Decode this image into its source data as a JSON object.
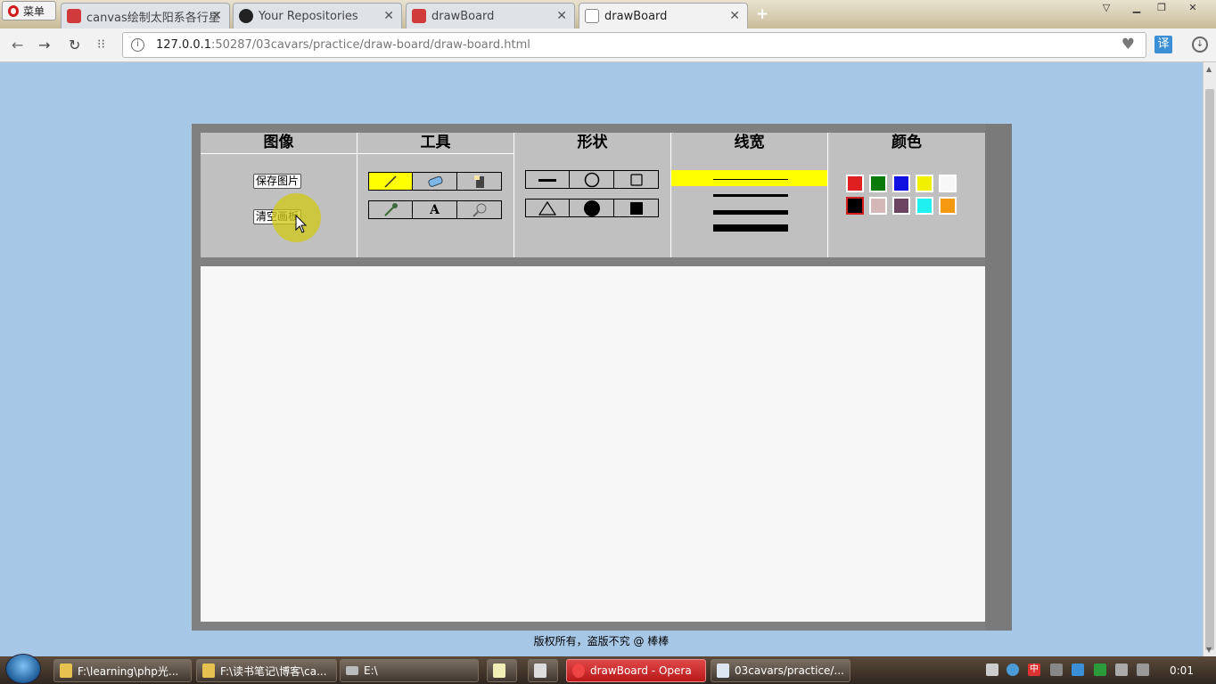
{
  "browser": {
    "menu_label": "菜单",
    "tabs": [
      {
        "title": "canvas绘制太阳系各行星",
        "favicon_color": "#d03a3a"
      },
      {
        "title": "Your Repositories",
        "favicon_color": "#222222"
      },
      {
        "title": "drawBoard",
        "favicon_color": "#d03a3a"
      },
      {
        "title": "drawBoard",
        "favicon_color": "#888888"
      }
    ],
    "url_host": "127.0.0.1",
    "url_rest": ":50287/03cavars/practice/draw-board/draw-board.html",
    "translate_label": "译"
  },
  "board": {
    "sections": [
      {
        "title": "图像",
        "buttons": [
          "保存图片",
          "清空画板"
        ]
      },
      {
        "title": "工具"
      },
      {
        "title": "形状"
      },
      {
        "title": "线宽"
      },
      {
        "title": "颜色"
      }
    ],
    "tool_text_label": "A",
    "selected_line_width_index": 0,
    "colors_row1": [
      "#e02020",
      "#0a7a0a",
      "#1010e0",
      "#f0f000",
      "#f7f7f7"
    ],
    "colors_row2": [
      "#000000",
      "#d4b8b8",
      "#6a4460",
      "#20f0f0",
      "#f59a10"
    ],
    "selected_color_index": 5,
    "footer": "版权所有，盗版不究 @ 棒棒"
  },
  "taskbar": {
    "items": [
      "F:\\learning\\php光...",
      "F:\\读书笔记\\博客\\ca...",
      "E:\\",
      "drawBoard - Opera",
      "03cavars/practice/..."
    ],
    "ime": "中",
    "clock": "0:01"
  }
}
